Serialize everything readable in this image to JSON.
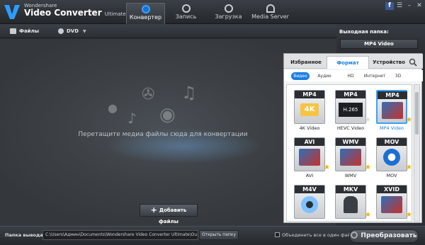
{
  "app": {
    "brand_top": "Wondershare",
    "brand_name": "Video Converter",
    "brand_edition": "Ultimate"
  },
  "nav_tabs": [
    {
      "label": "Конвертер",
      "icon": "convert-icon",
      "active": true
    },
    {
      "label": "Запись",
      "icon": "burn-icon",
      "active": false
    },
    {
      "label": "Загрузка",
      "icon": "download-icon",
      "active": false
    },
    {
      "label": "Media Server",
      "icon": "wifi-icon",
      "active": false
    }
  ],
  "window_controls": {
    "facebook": "f",
    "menu": "☰",
    "minimize": "–",
    "close": "✕"
  },
  "toolbar": {
    "files_label": "Файлы",
    "dvd_label": "DVD"
  },
  "main": {
    "drop_text": "Перетащите медиа файлы сюда для конвертации",
    "add_files_label": "Добавить файлы"
  },
  "output_panel": {
    "label": "Выходная папка:",
    "selected": "MP4 Video"
  },
  "format_dropdown": {
    "tabs": [
      {
        "label": "Избранное",
        "active": false
      },
      {
        "label": "Формат",
        "active": true
      },
      {
        "label": "Устройство",
        "active": false
      }
    ],
    "subtabs": [
      {
        "label": "Видео",
        "active": true
      },
      {
        "label": "Аудио",
        "active": false
      },
      {
        "label": "HD",
        "active": false
      },
      {
        "label": "Интернет",
        "active": false
      },
      {
        "label": "3D",
        "active": false
      }
    ],
    "formats": [
      {
        "badge": "MP4",
        "sub": "4K",
        "name": "4K Video",
        "selected": false,
        "star": false
      },
      {
        "badge": "MP4",
        "sub": "H.265",
        "name": "HEVC Video",
        "selected": false,
        "star": true
      },
      {
        "badge": "MP4",
        "sub": "",
        "name": "MP4 Video",
        "selected": true,
        "star": true
      },
      {
        "badge": "AVI",
        "sub": "",
        "name": "AVI",
        "selected": false,
        "star": true
      },
      {
        "badge": "WMV",
        "sub": "",
        "name": "WMV",
        "selected": false,
        "star": true
      },
      {
        "badge": "MOV",
        "sub": "",
        "name": "MOV",
        "selected": false,
        "star": true
      },
      {
        "badge": "M4V",
        "sub": "",
        "name": "",
        "selected": false,
        "star": false
      },
      {
        "badge": "MKV",
        "sub": "",
        "name": "",
        "selected": false,
        "star": true
      },
      {
        "badge": "XVID",
        "sub": "",
        "name": "",
        "selected": false,
        "star": true
      }
    ]
  },
  "bottom": {
    "output_label": "Папка вывода",
    "path": "C:\\Users\\Админ\\Documents\\Wondershare Video Converter Ultimate\\Ou",
    "open_folder": "Открыть папку",
    "merge_label": "Объединить все в один файл",
    "convert_label": "Преобразовать"
  },
  "colors": {
    "accent": "#1a7ee0",
    "star": "#f0b400",
    "dark_bg": "#2b2f34"
  }
}
